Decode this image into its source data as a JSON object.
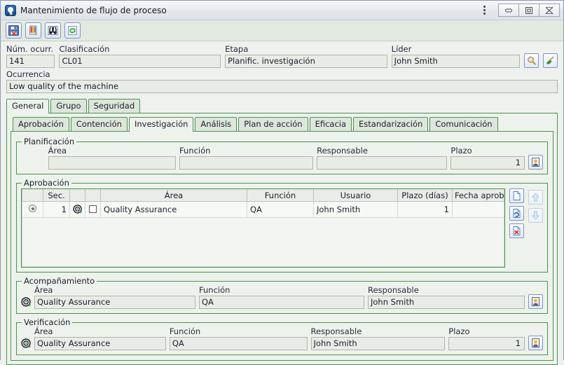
{
  "window": {
    "title": "Mantenimiento de flujo de proceso",
    "app_icon": "process-app-icon",
    "controls": {
      "menu": "more-options",
      "minimize": "Minimizar",
      "maximize": "Maximizar",
      "close": "Cerrar"
    }
  },
  "toolbar": {
    "buttons": [
      {
        "name": "save-button",
        "icon": "floppy-disk-icon",
        "tooltip": "Guardar"
      },
      {
        "name": "attachment-button",
        "icon": "document-color-icon",
        "tooltip": "Adjuntos"
      },
      {
        "name": "find-button",
        "icon": "binoculars-icon",
        "tooltip": "Buscar"
      },
      {
        "name": "refresh-button",
        "icon": "refresh-icon",
        "tooltip": "Actualizar"
      }
    ]
  },
  "header": {
    "num_ocurr": {
      "label": "Núm. ocurr.",
      "value": "141"
    },
    "clasificacion": {
      "label": "Clasificación",
      "value": "CL01"
    },
    "etapa": {
      "label": "Etapa",
      "value": "Planific. investigación"
    },
    "lider": {
      "label": "Líder",
      "value": "John Smith"
    },
    "lider_search_icon": "magnifier-icon",
    "lider_clear_icon": "broom-icon",
    "ocurrencia": {
      "label": "Ocurrencia",
      "value": "Low quality of the machine"
    }
  },
  "tabs_outer": {
    "items": [
      "General",
      "Grupo",
      "Seguridad"
    ],
    "active": "General"
  },
  "tabs_inner": {
    "items": [
      "Aprobación",
      "Contención",
      "Investigación",
      "Análisis",
      "Plan de acción",
      "Eficacia",
      "Estandarización",
      "Comunicación"
    ],
    "active": "Investigación"
  },
  "planificacion": {
    "title": "Planificación",
    "area": {
      "label": "Área",
      "value": ""
    },
    "funcion": {
      "label": "Función",
      "value": ""
    },
    "responsable": {
      "label": "Responsable",
      "value": ""
    },
    "plazo": {
      "label": "Plazo",
      "value": "1"
    },
    "picker_icon": "person-card-icon"
  },
  "aprobacion": {
    "title": "Aprobación",
    "columns": [
      "",
      "Sec.",
      "",
      "",
      "Área",
      "Función",
      "Usuario",
      "Plazo (días)",
      "Fecha aprob."
    ],
    "rows": [
      {
        "selected": true,
        "sec": "1",
        "target_icon": "target-icon",
        "checked": false,
        "area": "Quality Assurance",
        "funcion": "QA",
        "usuario": "John Smith",
        "plazo_dias": "1",
        "fecha_aprob": ""
      }
    ],
    "side_buttons": [
      {
        "name": "new-row-button",
        "icon": "new-document-icon",
        "disabled": false
      },
      {
        "name": "edit-row-button",
        "icon": "refresh-document-icon",
        "disabled": false
      },
      {
        "name": "delete-row-button",
        "icon": "delete-document-icon",
        "disabled": false
      }
    ],
    "order_buttons": [
      {
        "name": "move-up-button",
        "icon": "arrow-up-icon",
        "disabled": true
      },
      {
        "name": "move-down-button",
        "icon": "arrow-down-icon",
        "disabled": true
      }
    ]
  },
  "acompanamiento": {
    "title": "Acompañamiento",
    "target_icon": "target-icon",
    "area": {
      "label": "Área",
      "value": "Quality Assurance"
    },
    "funcion": {
      "label": "Función",
      "value": "QA"
    },
    "responsable": {
      "label": "Responsable",
      "value": "John Smith"
    },
    "picker_icon": "person-card-icon"
  },
  "verificacion": {
    "title": "Verificación",
    "target_icon": "target-icon",
    "area": {
      "label": "Área",
      "value": "Quality Assurance"
    },
    "funcion": {
      "label": "Función",
      "value": "QA"
    },
    "responsable": {
      "label": "Responsable",
      "value": "John Smith"
    },
    "plazo": {
      "label": "Plazo",
      "value": "1"
    },
    "picker_icon": "person-card-icon"
  },
  "colors": {
    "accent_green": "#4e9150",
    "panel_bg": "#edf2ec",
    "window_bg": "#eef1ee",
    "field_bg": "#e8ece7",
    "toolbar_bg": "#e2e9e0"
  }
}
